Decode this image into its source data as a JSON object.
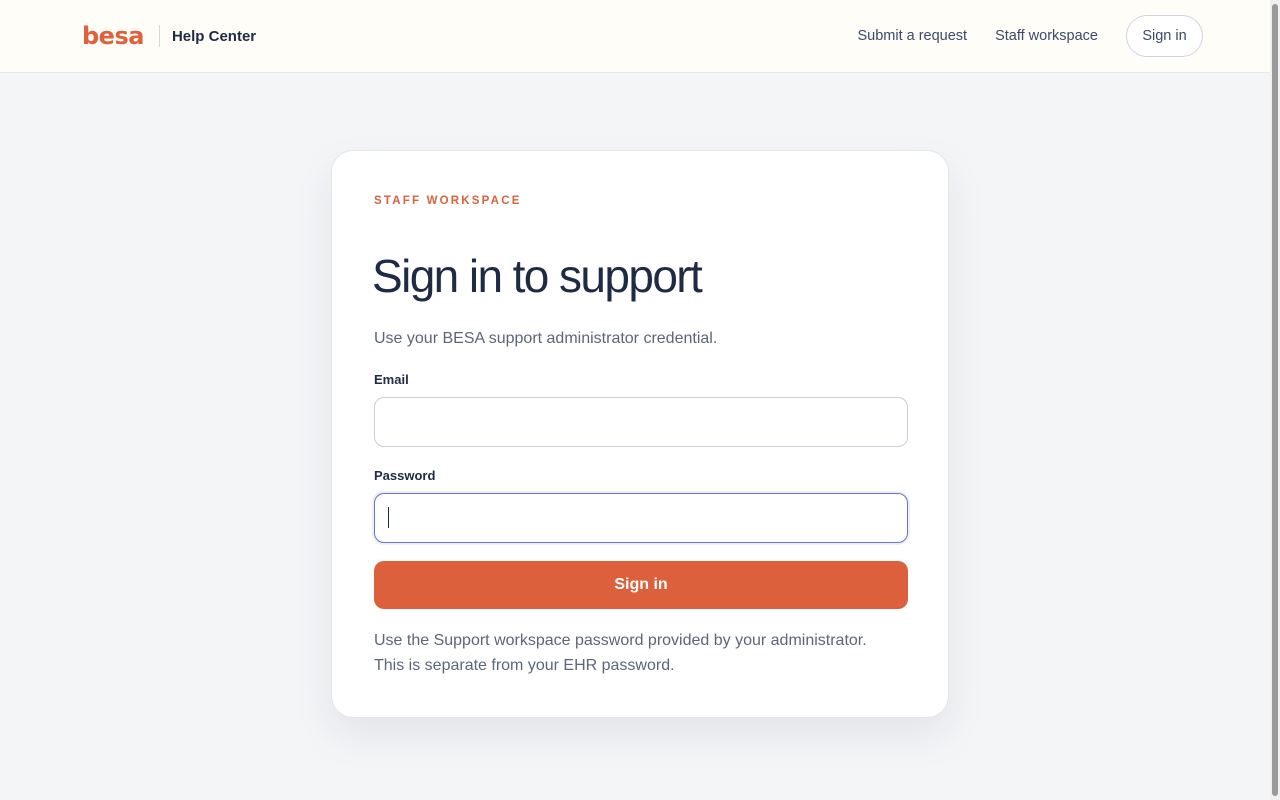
{
  "header": {
    "logo_text": "besa",
    "title": "Help Center",
    "nav": {
      "submit_request": "Submit a request",
      "staff_workspace": "Staff workspace",
      "sign_in": "Sign in"
    }
  },
  "card": {
    "eyebrow": "STAFF WORKSPACE",
    "title": "Sign in to support",
    "subtitle": "Use your BESA support administrator credential.",
    "email": {
      "label": "Email",
      "value": "",
      "placeholder": ""
    },
    "password": {
      "label": "Password",
      "value": "",
      "placeholder": ""
    },
    "submit_label": "Sign in",
    "helper_line_1": "Use the Support workspace password provided by your administrator.",
    "helper_line_2": "This is separate from your EHR password."
  },
  "colors": {
    "accent": "#dd603c",
    "header_bg": "#fffdf8",
    "page_bg": "#f4f5f7",
    "focus_ring": "#6a74c9"
  }
}
